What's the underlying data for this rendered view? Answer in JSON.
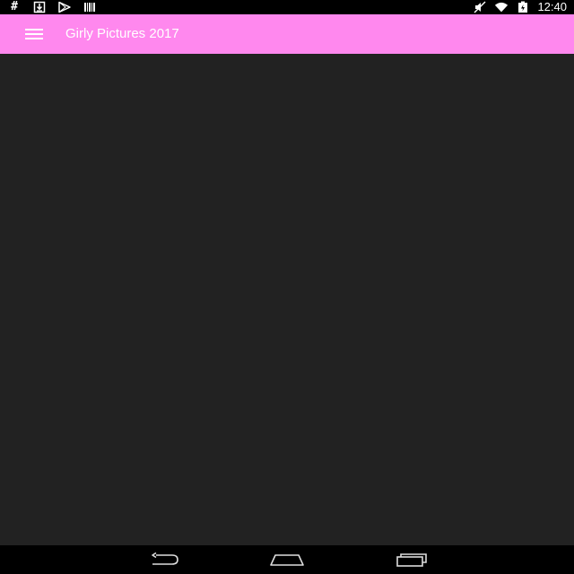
{
  "status_bar": {
    "left_icons": [
      "hash-icon",
      "download-icon",
      "play-store-icon",
      "barcode-icon"
    ],
    "right_icons": [
      "mute-icon",
      "wifi-icon",
      "battery-icon"
    ],
    "hash_glyph": "#",
    "time": "12:40"
  },
  "app_bar": {
    "title": "Girly Pictures 2017",
    "menu_icon": "hamburger-menu-icon",
    "background": "#ff88ee"
  },
  "content": {
    "background": "#222222"
  },
  "nav_bar": {
    "buttons": [
      "back-icon",
      "home-icon",
      "recent-apps-icon"
    ]
  }
}
